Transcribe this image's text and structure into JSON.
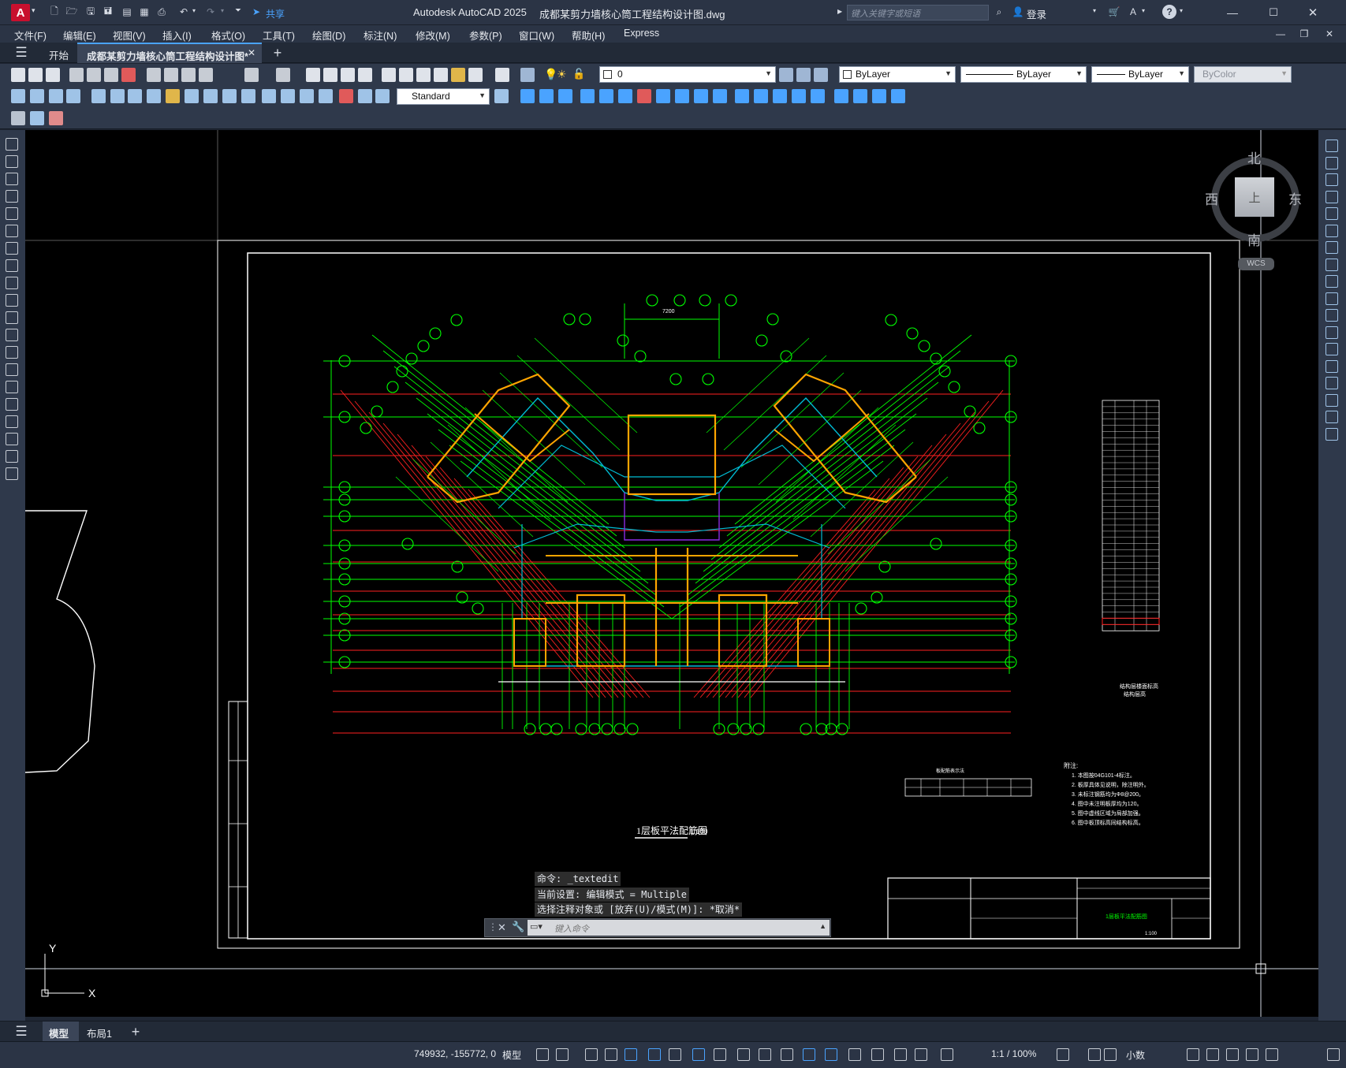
{
  "titlebar": {
    "app_name": "Autodesk AutoCAD 2025",
    "file_name": "成都某剪力墙核心筒工程结构设计图.dwg",
    "share_label": "共享",
    "search_placeholder": "键入关键字或短语",
    "login_label": "登录"
  },
  "menu": {
    "items": [
      "文件(F)",
      "编辑(E)",
      "视图(V)",
      "插入(I)",
      "格式(O)",
      "工具(T)",
      "绘图(D)",
      "标注(N)",
      "修改(M)",
      "参数(P)",
      "窗口(W)",
      "帮助(H)",
      "Express"
    ]
  },
  "doc_tabs": {
    "start_label": "开始",
    "active_label": "成都某剪力墙核心筒工程结构设计图*"
  },
  "toolbar": {
    "layer_value": "0",
    "color_value": "ByLayer",
    "linetype_value": "ByLayer",
    "lineweight_value": "ByLayer",
    "plotstyle_value": "ByColor",
    "dimstyle_value": "Standard"
  },
  "viewcube": {
    "north": "北",
    "south": "南",
    "east": "东",
    "west": "西",
    "top": "上",
    "wcs": "WCS"
  },
  "ucs": {
    "y_label": "Y",
    "x_label": "X"
  },
  "drawing": {
    "plan_title": "1层板平法配筋图",
    "plan_scale": "1:100",
    "notes_heading": "附注:",
    "notes": [
      "1. 本图按04G101-4标注。",
      "2. 板厚具体见说明，除注明外。",
      "3. 未标注钢筋均为Φ8@200。",
      "4. 图中未注明板厚均为120。",
      "5. 图中虚线区域为局部加强。",
      "6. 图中板顶标高同结构标高。"
    ],
    "table_caption": "结构层楼面标高",
    "table_caption2": "结构层高",
    "dim_top": "7200",
    "legend_title": "板配筋表示法",
    "titleblock_title": "1层板平法配筋图",
    "titleblock_scale": "1:100"
  },
  "commandline": {
    "history": [
      "命令: _textedit",
      "当前设置: 编辑模式 = Multiple",
      "选择注释对象或 [放弃(U)/模式(M)]: *取消*"
    ],
    "input_placeholder": "键入命令"
  },
  "layout_tabs": {
    "model": "模型",
    "layout1": "布局1"
  },
  "status": {
    "coords": "749932, -155772, 0",
    "space": "模型",
    "scale": "1:1 / 100%",
    "units": "小数"
  },
  "colors": {
    "axis_green": "#00ff00",
    "wall_orange": "#ffa500",
    "beam_cyan": "#00bcd4",
    "rebar_red": "#ff2020"
  }
}
